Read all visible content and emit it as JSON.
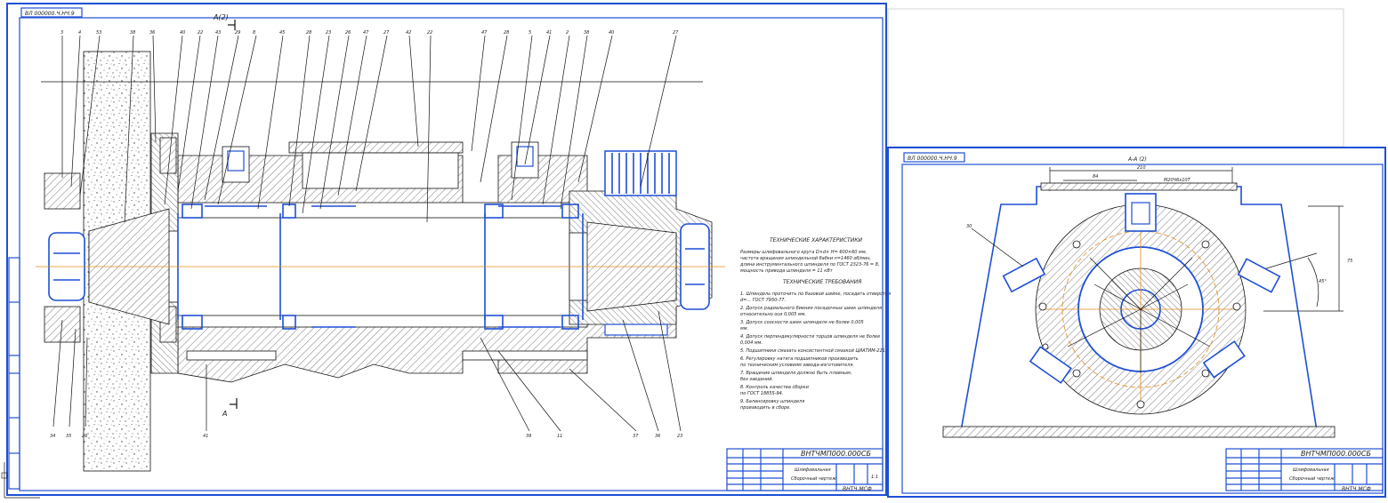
{
  "sheet_left": {
    "stamp_code_top": "ВЛ 000000.Ч.НЧ.9",
    "section_mark_top": "А(2)",
    "section_mark_bottom": "А",
    "tech_chars_title": "ТЕХНИЧЕСКИЕ ХАРАКТЕРИСТИКИ",
    "tech_chars_lines": [
      "Размеры шлифовального круга D×d× H= 600×60 мм,",
      "частота вращения шпиндельной бабки n=1460 об/мин,",
      "длина инструментального шпинделя по ГОСТ 2323-76 = 8,",
      "мощность привода шпинделя = 11 кВт"
    ],
    "tech_req_title": "ТЕХНИЧЕСКИЕ ТРЕБОВАНИЯ",
    "tech_req_lines": [
      "1. Шпиндель проточить по базовой шейке, посадить отверстия",
      "d=... ГОСТ 7950-77.",
      "2. Допуск радиального биения посадочных шеек шпинделя",
      "относительно оси 0,005 мм.",
      "3. Допуск соосности шеек шпинделя не более 0,005",
      "мм.",
      "4. Допуск перпендикулярности торцов шпинделя не более",
      "0,004 мм.",
      "5. Подшипники смазать консистентной смазкой ЦИАТИМ-221.",
      "6. Регулировку натяга подшипников производить",
      "по техническим условиям завода-изготовителя.",
      "7. Вращение шпинделя должно быть плавным,",
      "без заеданий.",
      "8. Контроль качества сборки",
      "по ГОСТ 18855-94.",
      "9. Балансировку шпинделя",
      "производить в сборе."
    ],
    "stamp_code": "ВНТЧМП000.000СБ",
    "stamp_title_1": "Шлифовальная",
    "stamp_title_2": "Сборочный чертеж",
    "stamp_org": "ВНТЧ МСФ",
    "stamp_sheet": "1:1",
    "callouts_top": [
      "3",
      "4",
      "53",
      "38",
      "36",
      "40",
      "22",
      "43",
      "29",
      "8",
      "45",
      "28",
      "23",
      "26",
      "47",
      "27",
      "42",
      "22",
      "47",
      "28",
      "5",
      "41",
      "2",
      "38",
      "40",
      "27"
    ],
    "callouts_bottom": [
      "34",
      "35",
      "26",
      "41",
      "39",
      "11",
      "37",
      "36",
      "23"
    ]
  },
  "sheet_right": {
    "stamp_code_top": "ВЛ 000000.Ч.НЧ.9",
    "section_title": "А-А (2)",
    "dim_top": "210",
    "dim_left": "84",
    "dim_right": "М20Ч6х10Т",
    "dim_height": "75",
    "dim_angle": "45°",
    "callout": "30",
    "stamp_code": "ВНТЧМП000.000СБ",
    "stamp_title_1": "Шлифовальная",
    "stamp_title_2": "Сборочный чертеж",
    "stamp_org": "ВНТЧ МСФ"
  },
  "colors": {
    "frame": "#1e4fd6",
    "axis": "#e08a1c",
    "line": "#111111"
  }
}
